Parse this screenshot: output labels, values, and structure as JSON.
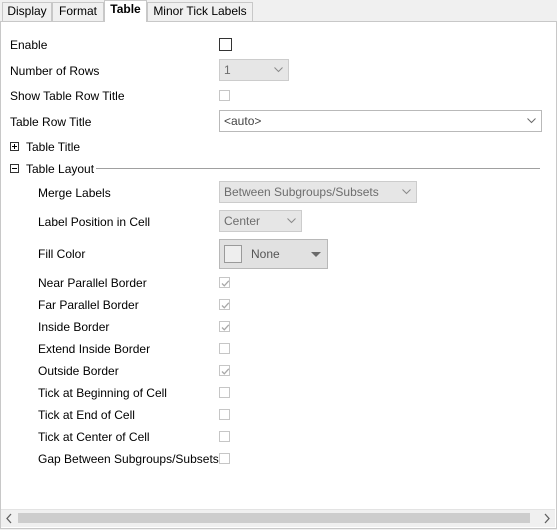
{
  "tabs": [
    {
      "label": "Display"
    },
    {
      "label": "Format"
    },
    {
      "label": "Table"
    },
    {
      "label": "Minor Tick Labels"
    }
  ],
  "top": {
    "enable": {
      "label": "Enable",
      "checked": false
    },
    "rows": {
      "label": "Number of Rows",
      "value": "1"
    },
    "show_row_title": {
      "label": "Show Table Row Title",
      "checked": false
    },
    "row_title": {
      "label": "Table Row Title",
      "value": "<auto>"
    }
  },
  "table_title": {
    "label": "Table Title"
  },
  "table_layout": {
    "label": "Table Layout",
    "merge_labels": {
      "label": "Merge Labels",
      "value": "Between Subgroups/Subsets"
    },
    "label_position": {
      "label": "Label Position in Cell",
      "value": "Center"
    },
    "fill_color": {
      "label": "Fill Color",
      "value": "None"
    },
    "checks": [
      {
        "label": "Near Parallel Border",
        "checked": true
      },
      {
        "label": "Far Parallel Border",
        "checked": true
      },
      {
        "label": "Inside Border",
        "checked": true
      },
      {
        "label": "Extend Inside Border",
        "checked": false
      },
      {
        "label": "Outside Border",
        "checked": true
      },
      {
        "label": "Tick at Beginning of Cell",
        "checked": false
      },
      {
        "label": "Tick at End of Cell",
        "checked": false
      },
      {
        "label": "Tick at Center of Cell",
        "checked": false
      },
      {
        "label": "Gap Between Subgroups/Subsets",
        "checked": false
      }
    ]
  }
}
